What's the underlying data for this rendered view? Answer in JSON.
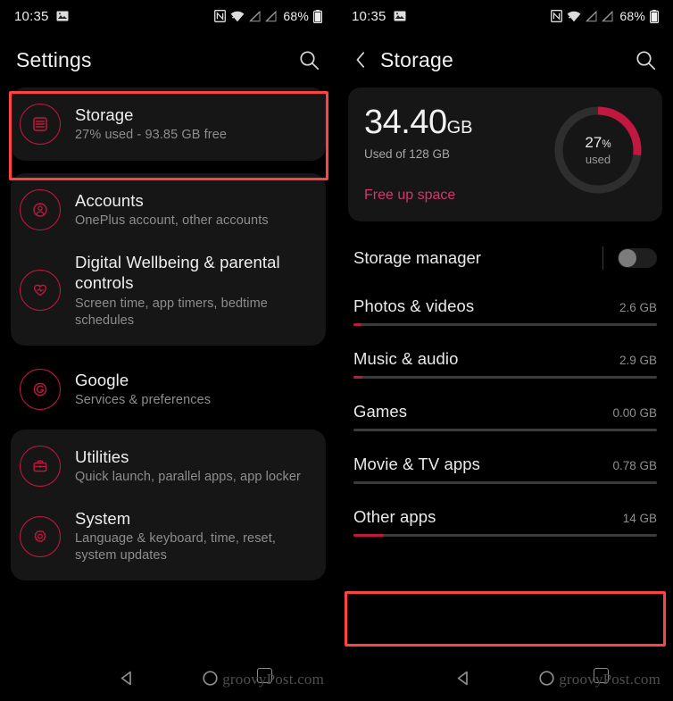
{
  "status_bar": {
    "time": "10:35",
    "battery_percent": "68%",
    "icons": [
      "image-icon",
      "nfc-icon",
      "wifi-icon",
      "no-sim-1-icon",
      "no-sim-2-icon",
      "battery-icon"
    ]
  },
  "left_screen": {
    "appbar": {
      "title": "Settings",
      "search_icon": "search-icon"
    },
    "highlighted_item": "Storage",
    "groups": [
      {
        "style": "card",
        "items": [
          {
            "icon": "storage-icon",
            "title": "Storage",
            "subtitle": "27% used - 93.85 GB free"
          }
        ]
      },
      {
        "style": "card",
        "items": [
          {
            "icon": "account-circle-icon",
            "title": "Accounts",
            "subtitle": "OnePlus account, other accounts"
          },
          {
            "icon": "heart-pulse-icon",
            "title": "Digital Wellbeing & parental controls",
            "subtitle": "Screen time, app timers, bedtime schedules"
          }
        ]
      },
      {
        "style": "flat",
        "items": [
          {
            "icon": "google-icon",
            "title": "Google",
            "subtitle": "Services & preferences"
          }
        ]
      },
      {
        "style": "card",
        "items": [
          {
            "icon": "briefcase-icon",
            "title": "Utilities",
            "subtitle": "Quick launch, parallel apps, app locker"
          },
          {
            "icon": "gear-icon",
            "title": "System",
            "subtitle": "Language & keyboard, time, reset, system updates"
          }
        ]
      }
    ]
  },
  "right_screen": {
    "appbar": {
      "back_icon": "chevron-left-icon",
      "title": "Storage",
      "search_icon": "search-icon"
    },
    "summary": {
      "used_value": "34.40",
      "used_unit": "GB",
      "capacity_text": "Used of 128 GB",
      "free_up_link": "Free up space",
      "donut_percent_value": "27",
      "donut_percent_symbol": "%",
      "donut_caption": "used",
      "donut_fraction": 0.27,
      "accent_color": "#c2173f",
      "track_color": "#2e2e2e"
    },
    "storage_manager": {
      "label": "Storage manager",
      "enabled": false
    },
    "highlighted_item": "Other apps",
    "categories": [
      {
        "name": "Photos & videos",
        "size": "2.6 GB",
        "fill_percent": 2.5
      },
      {
        "name": "Music & audio",
        "size": "2.9 GB",
        "fill_percent": 2.8
      },
      {
        "name": "Games",
        "size": "0.00 GB",
        "fill_percent": 0
      },
      {
        "name": "Movie & TV apps",
        "size": "0.78 GB",
        "fill_percent": 0
      },
      {
        "name": "Other apps",
        "size": "14 GB",
        "fill_percent": 10
      }
    ]
  },
  "nav_bar": {
    "back_icon": "triangle-back-icon",
    "home_icon": "circle-home-icon",
    "recents_icon": "square-recents-icon"
  },
  "watermark": "groovyPost.com"
}
